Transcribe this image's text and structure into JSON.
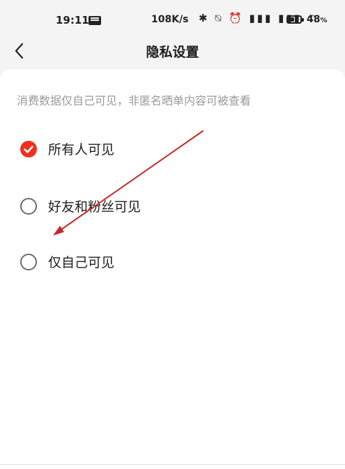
{
  "status_bar": {
    "time": "19:11",
    "network_speed": "108K/s",
    "status_icons": "✱ ⍉ ⏰ ▮▮▮ ▮▮▮ ◠",
    "battery_percent": "48",
    "battery_unit": "%",
    "battery_level": 0.48
  },
  "nav": {
    "title": "隐私设置",
    "back_icon": "chevron-left-icon"
  },
  "hint": "消费数据仅自己可见，非匿名晒单内容可被查看",
  "options": [
    {
      "label": "所有人可见",
      "selected": true
    },
    {
      "label": "好友和粉丝可见",
      "selected": false
    },
    {
      "label": "仅自己可见",
      "selected": false
    }
  ],
  "colors": {
    "accent": "#f0301e",
    "annotation_arrow": "#c62828",
    "hint_text": "#9a9a9a"
  }
}
